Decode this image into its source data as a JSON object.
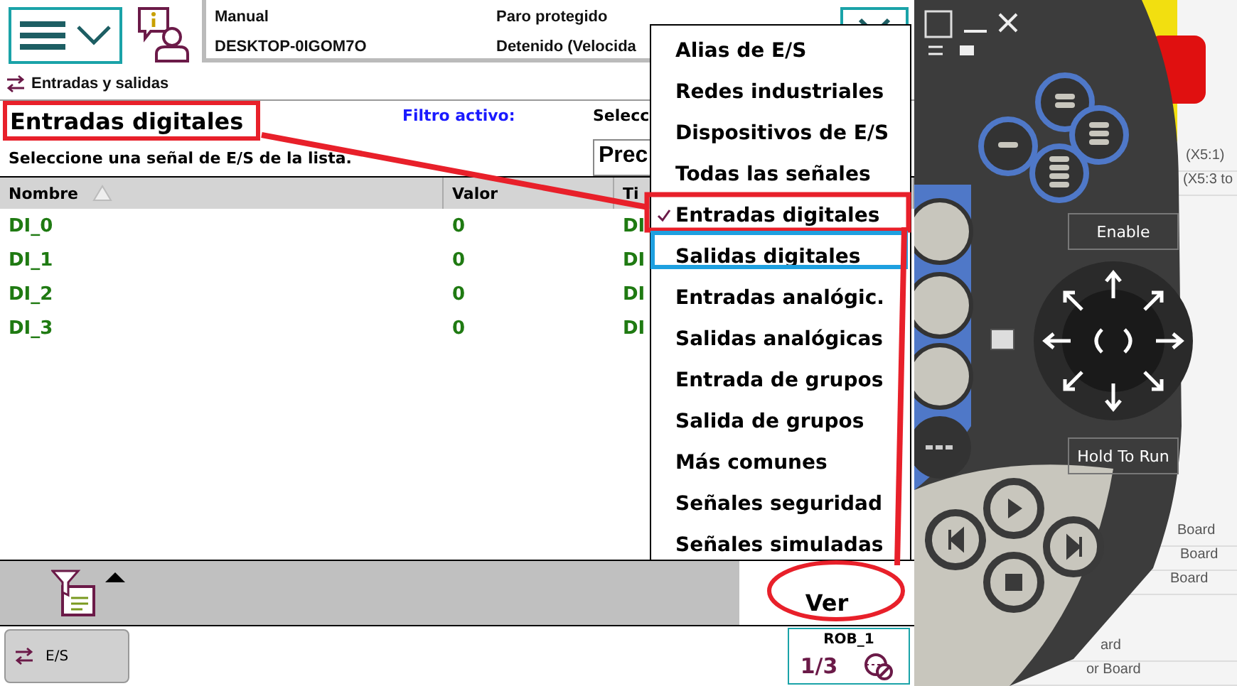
{
  "header": {
    "mode": "Manual",
    "system": "DESKTOP-0IGOM7O",
    "status": "Paro protegido",
    "state": "Detenido (Velocida"
  },
  "breadcrumb": "Entradas y salidas",
  "view": {
    "title": "Entradas digitales",
    "instruction": "Seleccione una señal de E/S de la lista.",
    "filter_label": "Filtro activo:",
    "select_label": "Selecc",
    "select_value": "Prec"
  },
  "table": {
    "columns": [
      "Nombre",
      "Valor",
      "Ti"
    ],
    "rows": [
      [
        "DI_0",
        "0",
        "DI"
      ],
      [
        "DI_1",
        "0",
        "DI"
      ],
      [
        "DI_2",
        "0",
        "DI"
      ],
      [
        "DI_3",
        "0",
        "DI"
      ]
    ]
  },
  "menu": {
    "items": [
      {
        "label": "Alias de E/S",
        "selected": false
      },
      {
        "label": "Redes industriales",
        "selected": false
      },
      {
        "label": "Dispositivos de E/S",
        "selected": false
      },
      {
        "label": "Todas las señales",
        "selected": false
      },
      {
        "label": "Entradas digitales",
        "selected": true
      },
      {
        "label": "Salidas digitales",
        "selected": false
      },
      {
        "label": "Entradas analógic.",
        "selected": false
      },
      {
        "label": "Salidas analógicas",
        "selected": false
      },
      {
        "label": "Entrada de grupos",
        "selected": false
      },
      {
        "label": "Salida de grupos",
        "selected": false
      },
      {
        "label": "Más comunes",
        "selected": false
      },
      {
        "label": "Señales seguridad",
        "selected": false
      },
      {
        "label": "Señales simuladas",
        "selected": false
      }
    ]
  },
  "toolbar": {
    "view_button": "Ver"
  },
  "taskbar": {
    "app_button": "E/S",
    "task": "ROB_1",
    "fraction": "1/3"
  },
  "pendant": {
    "enable_label": "Enable",
    "hold_label": "Hold To Run"
  },
  "background_window": {
    "texts": [
      "(X5:1)",
      "(X5:3 to",
      "Board",
      "Board",
      "Board",
      "ard",
      "or Board"
    ]
  }
}
